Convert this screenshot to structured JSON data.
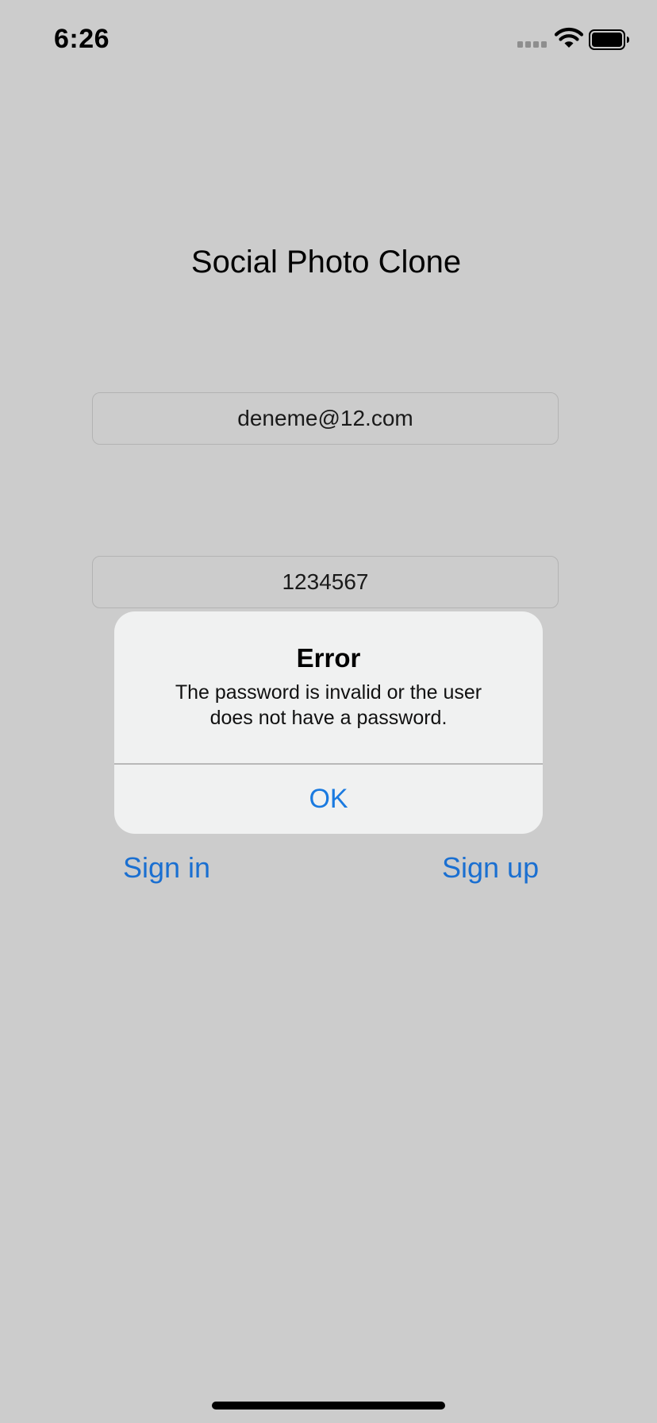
{
  "status_bar": {
    "time": "6:26",
    "icons": [
      "signal-icon",
      "wifi-icon",
      "battery-icon"
    ]
  },
  "login": {
    "title": "Social Photo Clone",
    "email_value": "deneme@12.com",
    "password_value": "1234567",
    "sign_in_label": "Sign in",
    "sign_up_label": "Sign up"
  },
  "alert": {
    "title": "Error",
    "message_line1": "The password is invalid or the user",
    "message_line2": "does not have a password.",
    "ok_label": "OK"
  },
  "colors": {
    "background": "#cccccc",
    "accent": "#1a6fd1",
    "alert_background": "#f0f1f1"
  }
}
